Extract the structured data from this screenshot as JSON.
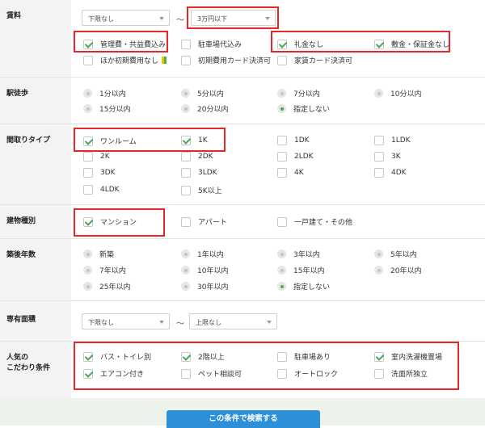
{
  "rent": {
    "label": "賃料",
    "min_select": "下限なし",
    "tilde": "〜",
    "max_select": "3万円以下",
    "options": [
      {
        "label": "管理費・共益費込み",
        "checked": true
      },
      {
        "label": "駐車場代込み",
        "checked": false
      },
      {
        "label": "礼金なし",
        "checked": true
      },
      {
        "label": "敷金・保証金なし",
        "checked": true
      },
      {
        "label": "ほか初期費用なし",
        "checked": false
      },
      {
        "label": "初期費用カード決済可",
        "checked": false
      },
      {
        "label": "家賃カード決済可",
        "checked": false
      }
    ]
  },
  "walk": {
    "label": "駅徒歩",
    "options": [
      {
        "label": "1分以内",
        "selected": false
      },
      {
        "label": "5分以内",
        "selected": false
      },
      {
        "label": "7分以内",
        "selected": false
      },
      {
        "label": "10分以内",
        "selected": false
      },
      {
        "label": "15分以内",
        "selected": false
      },
      {
        "label": "20分以内",
        "selected": false
      },
      {
        "label": "指定しない",
        "selected": true
      }
    ]
  },
  "layout": {
    "label": "間取りタイプ",
    "options": [
      {
        "label": "ワンルーム",
        "checked": true
      },
      {
        "label": "1K",
        "checked": true
      },
      {
        "label": "1DK",
        "checked": false
      },
      {
        "label": "1LDK",
        "checked": false
      },
      {
        "label": "2K",
        "checked": false
      },
      {
        "label": "2DK",
        "checked": false
      },
      {
        "label": "2LDK",
        "checked": false
      },
      {
        "label": "3K",
        "checked": false
      },
      {
        "label": "3DK",
        "checked": false
      },
      {
        "label": "3LDK",
        "checked": false
      },
      {
        "label": "4K",
        "checked": false
      },
      {
        "label": "4DK",
        "checked": false
      },
      {
        "label": "4LDK",
        "checked": false
      },
      {
        "label": "5K以上",
        "checked": false
      }
    ]
  },
  "building": {
    "label": "建物種別",
    "options": [
      {
        "label": "マンション",
        "checked": true
      },
      {
        "label": "アパート",
        "checked": false
      },
      {
        "label": "一戸建て・その他",
        "checked": false
      }
    ]
  },
  "age": {
    "label": "築後年数",
    "options": [
      {
        "label": "新築",
        "selected": false
      },
      {
        "label": "1年以内",
        "selected": false
      },
      {
        "label": "3年以内",
        "selected": false
      },
      {
        "label": "5年以内",
        "selected": false
      },
      {
        "label": "7年以内",
        "selected": false
      },
      {
        "label": "10年以内",
        "selected": false
      },
      {
        "label": "15年以内",
        "selected": false
      },
      {
        "label": "20年以内",
        "selected": false
      },
      {
        "label": "25年以内",
        "selected": false
      },
      {
        "label": "30年以内",
        "selected": false
      },
      {
        "label": "指定しない",
        "selected": true
      }
    ]
  },
  "area": {
    "label": "専有面積",
    "min_select": "下限なし",
    "tilde": "〜",
    "max_select": "上限なし"
  },
  "preferences": {
    "label_line1": "人気の",
    "label_line2": "こだわり条件",
    "options": [
      {
        "label": "バス・トイレ別",
        "checked": true
      },
      {
        "label": "2階以上",
        "checked": true
      },
      {
        "label": "駐車場あり",
        "checked": false
      },
      {
        "label": "室内洗濯機置場",
        "checked": true
      },
      {
        "label": "エアコン付き",
        "checked": true
      },
      {
        "label": "ペット相談可",
        "checked": false
      },
      {
        "label": "オートロック",
        "checked": false
      },
      {
        "label": "洗面所独立",
        "checked": false
      }
    ]
  },
  "search_button": "この条件で検索する",
  "colors": {
    "highlight": "#e8262a",
    "check": "#48a65a",
    "button": "#2d8fd8"
  },
  "icons": {
    "beginner_mark": "beginner-leaf-icon"
  }
}
